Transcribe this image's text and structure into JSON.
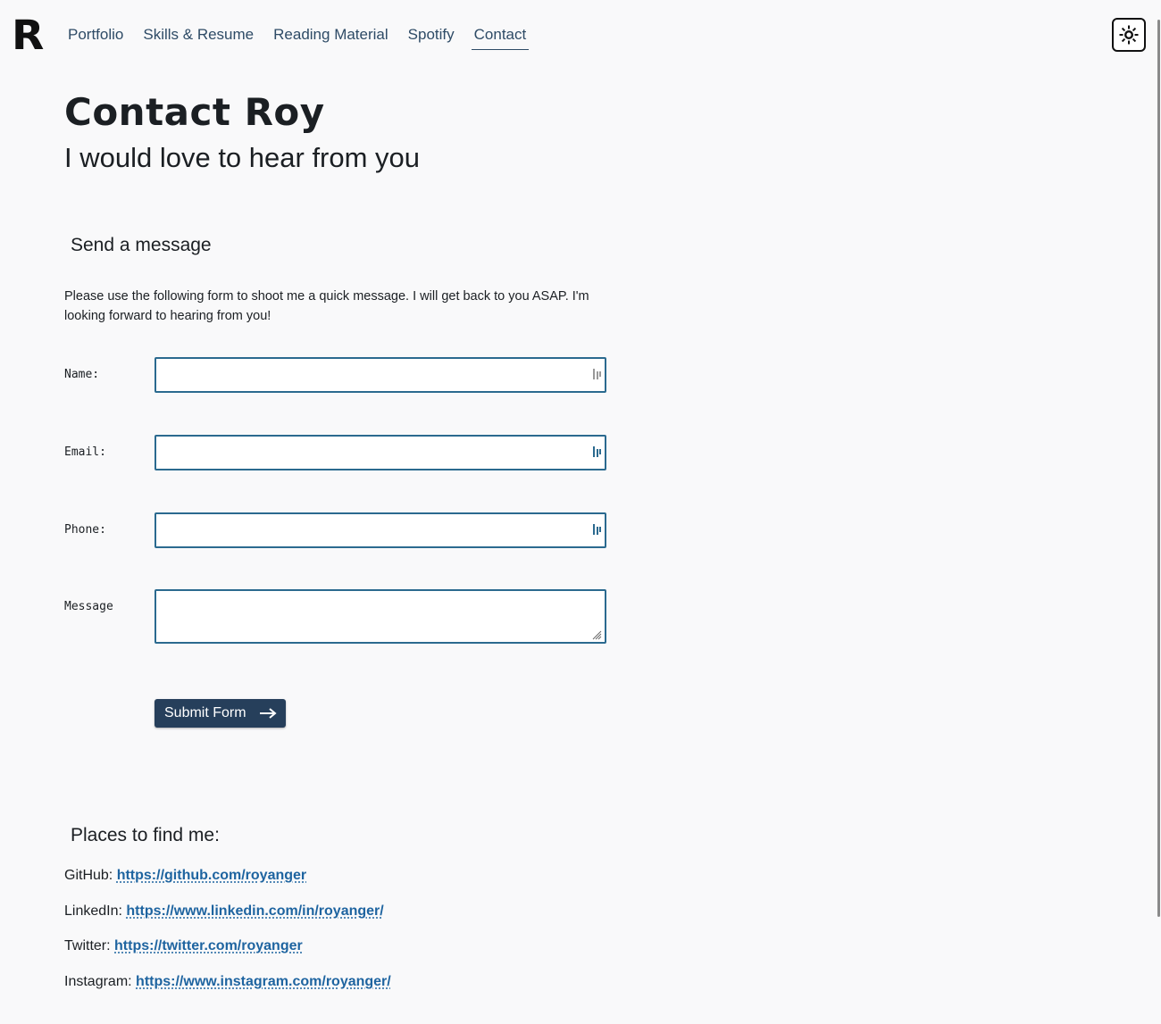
{
  "header": {
    "logo": "R",
    "nav": [
      "Portfolio",
      "Skills & Resume",
      "Reading Material",
      "Spotify",
      "Contact"
    ],
    "active_nav": "Contact",
    "theme_toggle_icon": "sun-icon"
  },
  "page": {
    "title": "Contact Roy",
    "subtitle": "I would love to hear from you"
  },
  "message_section": {
    "heading": "Send a message",
    "intro": "Please use the following form to shoot me a quick message. I will get back to you ASAP. I'm looking forward to hearing from you!"
  },
  "form": {
    "name_label": "Name:",
    "name_value": "",
    "email_label": "Email:",
    "email_value": "",
    "phone_label": "Phone:",
    "phone_value": "",
    "message_label": "Message",
    "message_value": "",
    "submit_label": "Submit Form",
    "submit_icon": "arrow-right-icon"
  },
  "social": {
    "heading": "Places to find me:",
    "links": [
      {
        "label": "GitHub:",
        "url": "https://github.com/royanger"
      },
      {
        "label": "LinkedIn:",
        "url": "https://www.linkedin.com/in/royanger/"
      },
      {
        "label": "Twitter:",
        "url": "https://twitter.com/royanger"
      },
      {
        "label": "Instagram:",
        "url": "https://www.instagram.com/royanger/"
      }
    ]
  },
  "colors": {
    "background": "#f9f9fa",
    "nav_text": "#2e4b66",
    "input_border": "#2b6a8f",
    "button_bg": "#263f5b",
    "link": "#1e64a0"
  }
}
